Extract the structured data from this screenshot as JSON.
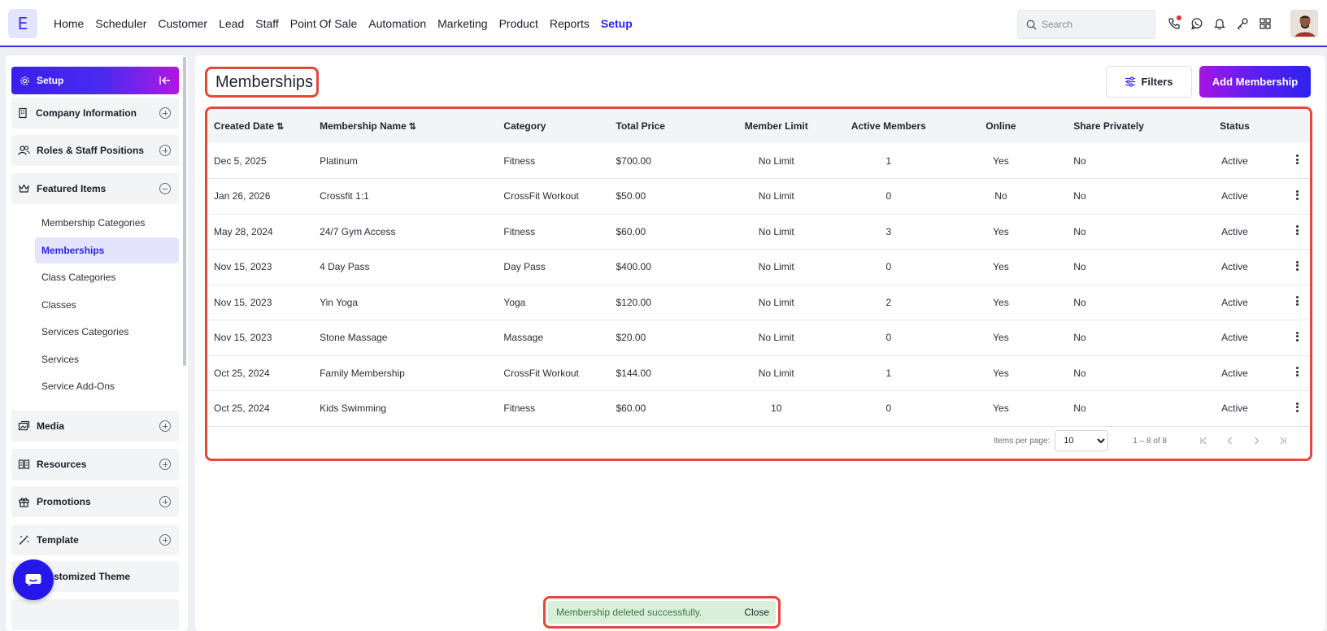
{
  "app": {
    "logo_letter": "E"
  },
  "nav": [
    {
      "label": "Home",
      "active": false
    },
    {
      "label": "Scheduler",
      "active": false
    },
    {
      "label": "Customer",
      "active": false
    },
    {
      "label": "Lead",
      "active": false
    },
    {
      "label": "Staff",
      "active": false
    },
    {
      "label": "Point Of Sale",
      "active": false
    },
    {
      "label": "Automation",
      "active": false
    },
    {
      "label": "Marketing",
      "active": false
    },
    {
      "label": "Product",
      "active": false
    },
    {
      "label": "Reports",
      "active": false
    },
    {
      "label": "Setup",
      "active": true
    }
  ],
  "search": {
    "placeholder": "Search",
    "value": ""
  },
  "top_icons": [
    "phone-icon",
    "whatsapp-icon",
    "bell-icon",
    "key-icon",
    "apps-grid-icon"
  ],
  "sidebar": {
    "header": "Setup",
    "sections": [
      {
        "label": "Company Information",
        "icon": "building-icon",
        "expanded": false
      },
      {
        "label": "Roles & Staff Positions",
        "icon": "users-icon",
        "expanded": false
      },
      {
        "label": "Featured Items",
        "icon": "crown-icon",
        "expanded": true
      },
      {
        "label": "Media",
        "icon": "media-icon",
        "expanded": false
      },
      {
        "label": "Resources",
        "icon": "resources-icon",
        "expanded": false
      },
      {
        "label": "Promotions",
        "icon": "gift-icon",
        "expanded": false
      },
      {
        "label": "Template",
        "icon": "wand-icon",
        "expanded": false
      },
      {
        "label": "Customized Theme",
        "visible_label": "stomized Theme",
        "icon": "theme-icon",
        "expanded": false
      }
    ],
    "featured_items": [
      {
        "label": "Membership Categories",
        "active": false
      },
      {
        "label": "Memberships",
        "active": true
      },
      {
        "label": "Class Categories",
        "active": false
      },
      {
        "label": "Classes",
        "active": false
      },
      {
        "label": "Services Categories",
        "active": false
      },
      {
        "label": "Services",
        "active": false
      },
      {
        "label": "Service Add-Ons",
        "active": false
      }
    ]
  },
  "main": {
    "title": "Memberships",
    "filters_label": "Filters",
    "add_label": "Add Membership",
    "columns": [
      "Created Date",
      "Membership Name",
      "Category",
      "Total Price",
      "Member Limit",
      "Active Members",
      "Online",
      "Share Privately",
      "Status"
    ],
    "rows": [
      [
        "Dec 5, 2025",
        "Platinum",
        "Fitness",
        "$700.00",
        "No Limit",
        "1",
        "Yes",
        "No",
        "Active"
      ],
      [
        "Jan 26, 2026",
        "Crossfit 1:1",
        "CrossFit Workout",
        "$50.00",
        "No Limit",
        "0",
        "No",
        "No",
        "Active"
      ],
      [
        "May 28, 2024",
        "24/7 Gym Access",
        "Fitness",
        "$60.00",
        "No Limit",
        "3",
        "Yes",
        "No",
        "Active"
      ],
      [
        "Nov 15, 2023",
        "4 Day Pass",
        "Day Pass",
        "$400.00",
        "No Limit",
        "0",
        "Yes",
        "No",
        "Active"
      ],
      [
        "Nov 15, 2023",
        "Yin Yoga",
        "Yoga",
        "$120.00",
        "No Limit",
        "2",
        "Yes",
        "No",
        "Active"
      ],
      [
        "Nov 15, 2023",
        "Stone Massage",
        "Massage",
        "$20.00",
        "No Limit",
        "0",
        "Yes",
        "No",
        "Active"
      ],
      [
        "Oct 25, 2024",
        "Family Membership",
        "CrossFit Workout",
        "$144.00",
        "No Limit",
        "1",
        "Yes",
        "No",
        "Active"
      ],
      [
        "Oct 25, 2024",
        "Kids Swimming",
        "Fitness",
        "$60.00",
        "10",
        "0",
        "Yes",
        "No",
        "Active"
      ]
    ],
    "pagination": {
      "items_per_page_label": "Items per page:",
      "items_per_page": "10",
      "range": "1 – 8 of 8"
    }
  },
  "toast": {
    "message": "Membership deleted successfully.",
    "close_label": "Close"
  }
}
